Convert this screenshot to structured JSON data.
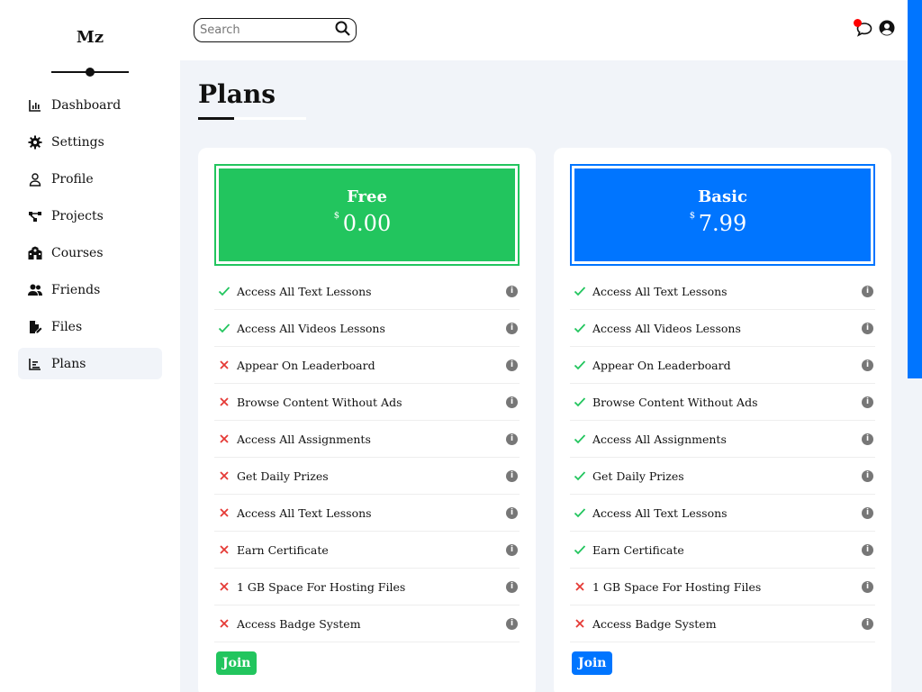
{
  "brand": {
    "logo": "Mz"
  },
  "sidebar": {
    "items": [
      {
        "label": "Dashboard",
        "icon": "chart-icon"
      },
      {
        "label": "Settings",
        "icon": "gear-icon"
      },
      {
        "label": "Profile",
        "icon": "user-icon"
      },
      {
        "label": "Projects",
        "icon": "diagram-icon"
      },
      {
        "label": "Courses",
        "icon": "school-icon"
      },
      {
        "label": "Friends",
        "icon": "users-icon"
      },
      {
        "label": "Files",
        "icon": "file-icon"
      },
      {
        "label": "Plans",
        "icon": "plans-chart-icon",
        "active": true
      }
    ]
  },
  "header": {
    "search_placeholder": "Search",
    "icons": [
      "search-icon",
      "comment-icon",
      "user-circle-icon"
    ],
    "notification_color": "#ff0000"
  },
  "page": {
    "title": "Plans"
  },
  "colors": {
    "green": "#22c55e",
    "blue": "#0075ff",
    "background": "#f1f4f9"
  },
  "plans": [
    {
      "name": "Free",
      "currency": "$",
      "price": "0.00",
      "join_label": "Join",
      "features": [
        {
          "label": "Access All Text Lessons",
          "included": true
        },
        {
          "label": "Access All Videos Lessons",
          "included": true
        },
        {
          "label": "Appear On Leaderboard",
          "included": false
        },
        {
          "label": "Browse Content Without Ads",
          "included": false
        },
        {
          "label": "Access All Assignments",
          "included": false
        },
        {
          "label": "Get Daily Prizes",
          "included": false
        },
        {
          "label": "Access All Text Lessons",
          "included": false
        },
        {
          "label": "Earn Certificate",
          "included": false
        },
        {
          "label": "1 GB Space For Hosting Files",
          "included": false
        },
        {
          "label": "Access Badge System",
          "included": false
        }
      ]
    },
    {
      "name": "Basic",
      "currency": "$",
      "price": "7.99",
      "join_label": "Join",
      "features": [
        {
          "label": "Access All Text Lessons",
          "included": true
        },
        {
          "label": "Access All Videos Lessons",
          "included": true
        },
        {
          "label": "Appear On Leaderboard",
          "included": true
        },
        {
          "label": "Browse Content Without Ads",
          "included": true
        },
        {
          "label": "Access All Assignments",
          "included": true
        },
        {
          "label": "Get Daily Prizes",
          "included": true
        },
        {
          "label": "Access All Text Lessons",
          "included": true
        },
        {
          "label": "Earn Certificate",
          "included": true
        },
        {
          "label": "1 GB Space For Hosting Files",
          "included": false
        },
        {
          "label": "Access Badge System",
          "included": false
        }
      ]
    }
  ]
}
